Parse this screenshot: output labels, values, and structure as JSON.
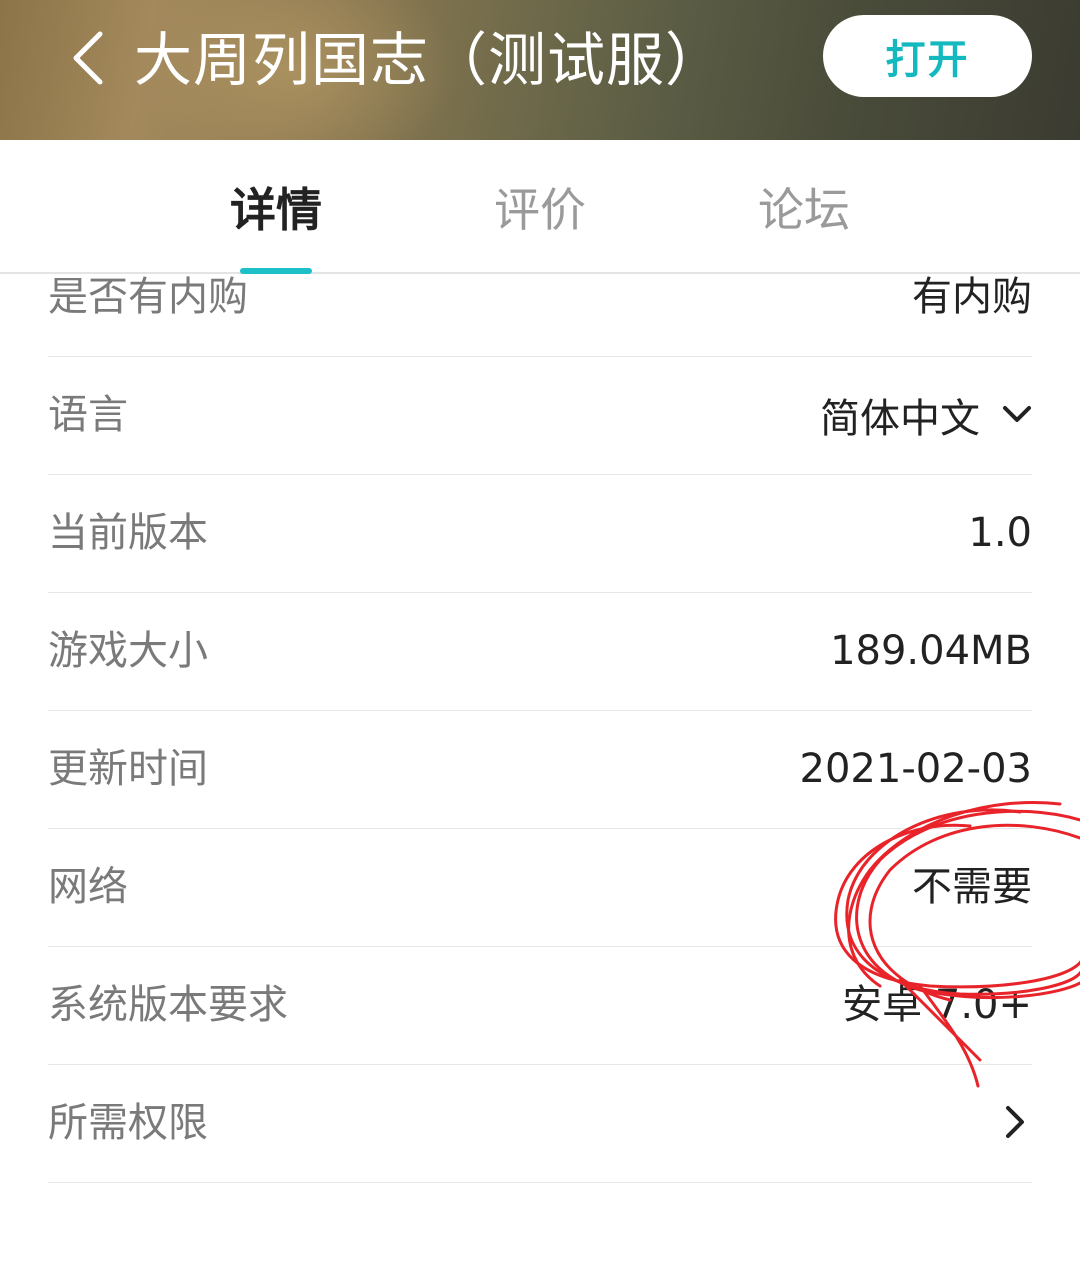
{
  "header": {
    "back_icon": "chevron-left-icon",
    "title": "大周列国志（测试服）",
    "open_label": "打开",
    "accent_color": "#14b9c0"
  },
  "tabs": [
    {
      "label": "详情",
      "active": true
    },
    {
      "label": "评价",
      "active": false
    },
    {
      "label": "论坛",
      "active": false
    }
  ],
  "details": [
    {
      "label": "是否有内购",
      "value": "有内购"
    },
    {
      "label": "语言",
      "value": "简体中文",
      "icon": "chevron-down-icon"
    },
    {
      "label": "当前版本",
      "value": "1.0"
    },
    {
      "label": "游戏大小",
      "value": "189.04MB"
    },
    {
      "label": "更新时间",
      "value": "2021-02-03"
    },
    {
      "label": "网络",
      "value": "不需要"
    },
    {
      "label": "系统版本要求",
      "value": "安卓 7.0+"
    },
    {
      "label": "所需权限",
      "value": "",
      "icon": "chevron-right-icon"
    }
  ],
  "annotation_color": "#e8242a"
}
